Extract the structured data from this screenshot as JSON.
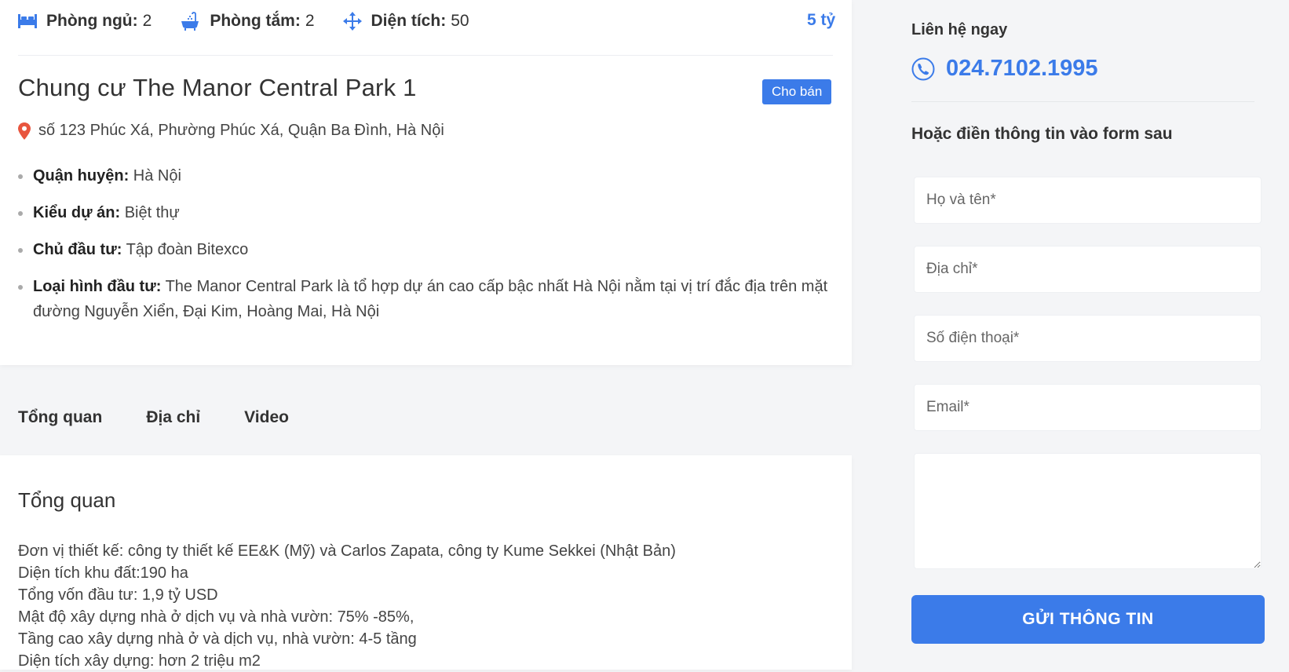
{
  "property": {
    "stats": {
      "bedrooms_label": "Phòng ngủ:",
      "bedrooms_value": "2",
      "bathrooms_label": "Phòng tắm:",
      "bathrooms_value": "2",
      "area_label": "Diện tích:",
      "area_value": "50"
    },
    "price": "5 tỷ",
    "title": "Chung cư The Manor Central Park 1",
    "badge": "Cho bán",
    "address": "số 123 Phúc Xá, Phường Phúc Xá, Quận Ba Đình, Hà Nội",
    "info": [
      {
        "label": "Quận huyện:",
        "value": "Hà Nội"
      },
      {
        "label": "Kiểu dự án:",
        "value": "Biệt thự"
      },
      {
        "label": "Chủ đầu tư:",
        "value": "Tập đoàn Bitexco"
      },
      {
        "label": "Loại hình đầu tư:",
        "value": "The Manor Central Park là tổ hợp dự án cao cấp bậc nhất Hà Nội nằm tại vị trí đắc địa trên mặt đường Nguyễn Xiển, Đại Kim, Hoàng Mai, Hà Nội"
      }
    ]
  },
  "tabs": [
    "Tổng quan",
    "Địa chỉ",
    "Video"
  ],
  "overview": {
    "title": "Tổng quan",
    "lines": [
      "Đơn vị thiết kế: công ty thiết kế  EE&K (Mỹ) và Carlos Zapata, công ty Kume Sekkei (Nhật Bản)",
      "Diện tích khu đất:190 ha",
      "Tổng vốn đầu tư: 1,9 tỷ USD",
      "Mật độ xây dựng nhà ở dịch vụ và nhà vườn: 75% -85%,",
      "Tầng cao xây dựng nhà ở và dịch vụ, nhà vườn: 4-5 tầng",
      "Diện tích xây dựng: hơn 2 triệu m2"
    ]
  },
  "contact": {
    "label": "Liên hệ ngay",
    "phone": "024.7102.1995",
    "form_heading": "Hoặc điền thông tin vào form sau",
    "placeholders": {
      "name": "Họ và tên*",
      "address": "Địa chỉ*",
      "phone": "Số điện thoại*",
      "email": "Email*",
      "message": ""
    },
    "submit_label": "Gửi thông tin"
  },
  "colors": {
    "accent": "#3b7be9",
    "page_bg": "#f4f5f7",
    "pin": "#e8553e"
  },
  "icons": [
    "bed-icon",
    "bathtub-icon",
    "move-arrows-icon",
    "map-pin-icon",
    "phone-icon"
  ]
}
